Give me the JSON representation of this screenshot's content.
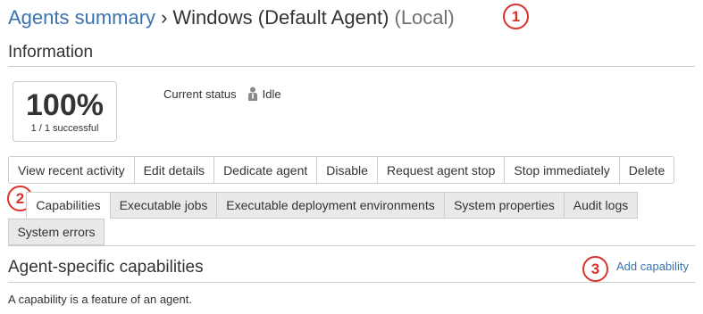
{
  "header": {
    "breadcrumb": "Agents summary",
    "separator": "›",
    "agent_name": "Windows (Default Agent)",
    "agent_scope": "(Local)"
  },
  "markers": [
    "1",
    "2",
    "3"
  ],
  "information": {
    "heading": "Information",
    "success_percent": "100%",
    "success_detail": "1 / 1 successful",
    "status_label": "Current status",
    "status_value": "Idle"
  },
  "actions": [
    "View recent activity",
    "Edit details",
    "Dedicate agent",
    "Disable",
    "Request agent stop",
    "Stop immediately",
    "Delete"
  ],
  "tabs": [
    "Capabilities",
    "Executable jobs",
    "Executable deployment environments",
    "System properties",
    "Audit logs",
    "System errors"
  ],
  "active_tab": "Capabilities",
  "capabilities": {
    "heading": "Agent-specific capabilities",
    "add_link": "Add capability",
    "description": "A capability is a feature of an agent."
  },
  "colors": {
    "link": "#3b73af",
    "marker": "#d9332e",
    "tab_inactive_bg": "#e9e9e9",
    "border": "#cccccc"
  }
}
